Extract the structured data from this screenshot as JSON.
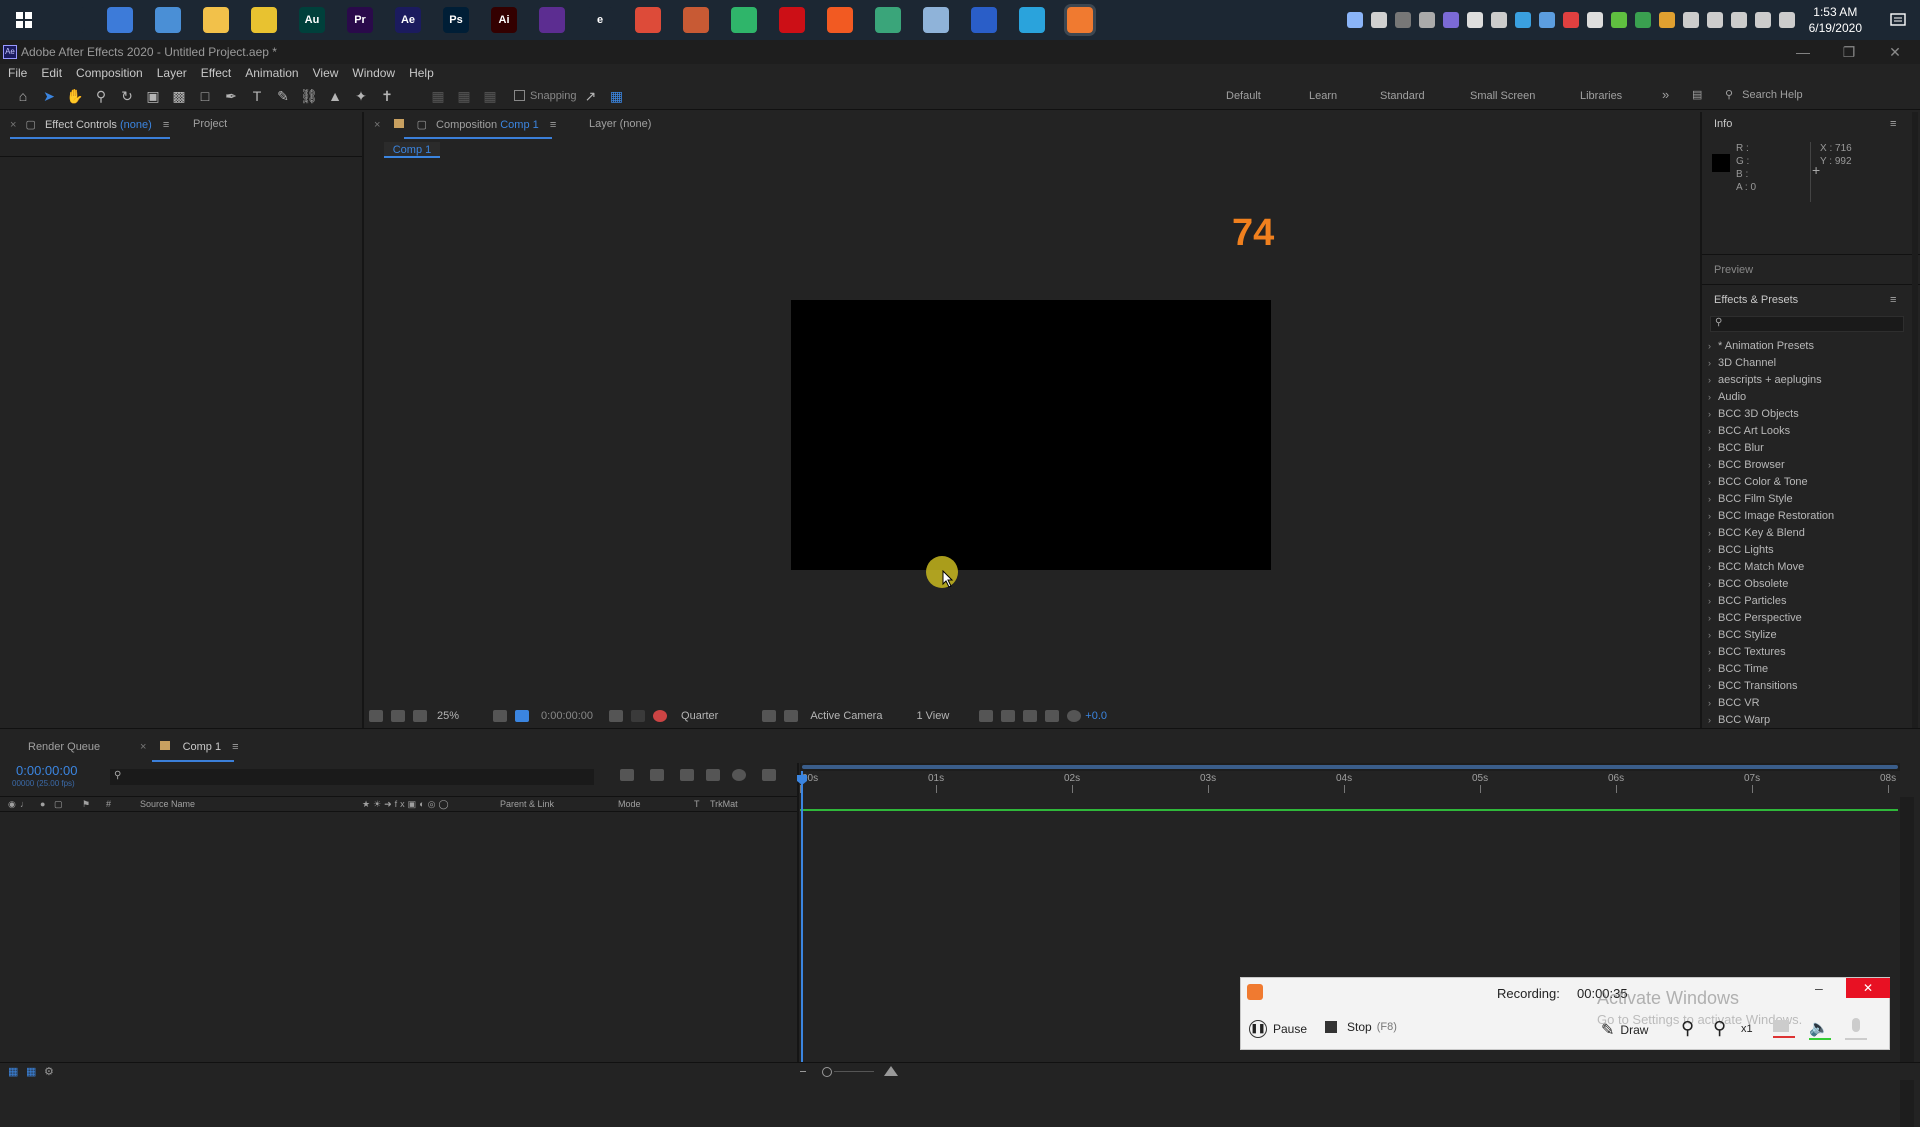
{
  "taskbar": {
    "apps": [
      {
        "name": "task-view-icon",
        "label": "",
        "color": "#1c2733"
      },
      {
        "name": "app-icon-1",
        "label": "",
        "color": "#3d7bd9"
      },
      {
        "name": "app-icon-2",
        "label": "",
        "color": "#4a8fd6"
      },
      {
        "name": "file-explorer-icon",
        "label": "",
        "color": "#f2c14a"
      },
      {
        "name": "app-icon-4",
        "label": "",
        "color": "#e8c230"
      },
      {
        "name": "audition-icon",
        "label": "Au",
        "color": "#00403b"
      },
      {
        "name": "premiere-icon",
        "label": "Pr",
        "color": "#2a0a4a"
      },
      {
        "name": "after-effects-icon",
        "label": "Ae",
        "color": "#1b1b5e"
      },
      {
        "name": "photoshop-icon",
        "label": "Ps",
        "color": "#001e36"
      },
      {
        "name": "illustrator-icon",
        "label": "Ai",
        "color": "#330000"
      },
      {
        "name": "visual-studio-icon",
        "label": "",
        "color": "#5c2d91"
      },
      {
        "name": "edge-legacy-icon",
        "label": "e",
        "color": "#1c2733"
      },
      {
        "name": "chrome-icon",
        "label": "",
        "color": "#dd4b39"
      },
      {
        "name": "chrome-alt-icon",
        "label": "",
        "color": "#c85a34"
      },
      {
        "name": "edge-dev-icon",
        "label": "",
        "color": "#2fb56a"
      },
      {
        "name": "opera-icon",
        "label": "",
        "color": "#cc0f16"
      },
      {
        "name": "brave-icon",
        "label": "",
        "color": "#f25a22"
      },
      {
        "name": "app-icon-17",
        "label": "",
        "color": "#3aa57a"
      },
      {
        "name": "app-icon-18",
        "label": "",
        "color": "#8fb3d9"
      },
      {
        "name": "app-icon-19",
        "label": "",
        "color": "#2a5ec8"
      },
      {
        "name": "telegram-icon",
        "label": "",
        "color": "#2aa3dc"
      },
      {
        "name": "recorder-app-icon",
        "label": "",
        "color": "#f07a30"
      }
    ],
    "clock_time": "1:53 AM",
    "clock_date": "6/19/2020"
  },
  "window": {
    "title": "Adobe After Effects 2020 - Untitled Project.aep *",
    "logo": "Ae"
  },
  "menu": [
    "File",
    "Edit",
    "Composition",
    "Layer",
    "Effect",
    "Animation",
    "View",
    "Window",
    "Help"
  ],
  "toolbar": {
    "snapping_label": "Snapping",
    "workspaces": [
      "Default",
      "Learn",
      "Standard",
      "Small Screen",
      "Libraries"
    ],
    "search_placeholder": "Search Help"
  },
  "left_panel": {
    "effect_controls_label": "Effect Controls",
    "effect_controls_value": "(none)",
    "project_label": "Project"
  },
  "comp_panel": {
    "tab_label": "Composition",
    "tab_value": "Comp 1",
    "layer_tab": "Layer (none)",
    "breadcrumb": "Comp 1",
    "overlay_number": "74",
    "zoom": "25%",
    "timecode": "0:00:00:00",
    "resolution": "Quarter",
    "camera": "Active Camera",
    "view": "1 View",
    "exposure": "+0.0"
  },
  "info_panel": {
    "title": "Info",
    "r": "R :",
    "g": "G :",
    "b": "B :",
    "a": "A :  0",
    "x": "X : 716",
    "y": "Y : 992"
  },
  "preview_panel": {
    "title": "Preview"
  },
  "effects_panel": {
    "title": "Effects & Presets",
    "items": [
      "* Animation Presets",
      "3D Channel",
      "aescripts + aeplugins",
      "Audio",
      "BCC 3D Objects",
      "BCC Art Looks",
      "BCC Blur",
      "BCC Browser",
      "BCC Color & Tone",
      "BCC Film Style",
      "BCC Image Restoration",
      "BCC Key & Blend",
      "BCC Lights",
      "BCC Match Move",
      "BCC Obsolete",
      "BCC Particles",
      "BCC Perspective",
      "BCC Stylize",
      "BCC Textures",
      "BCC Time",
      "BCC Transitions",
      "BCC VR",
      "BCC Warp"
    ]
  },
  "timeline": {
    "render_queue_tab": "Render Queue",
    "comp_tab": "Comp 1",
    "timecode": "0:00:00:00",
    "fps": "00000 (25.00 fps)",
    "col_source": "Source Name",
    "col_parent": "Parent & Link",
    "col_mode": "Mode",
    "col_t": "T",
    "col_trkmat": "TrkMat",
    "ruler": [
      "00s",
      "01s",
      "02s",
      "03s",
      "04s",
      "05s",
      "06s",
      "07s",
      "08s"
    ]
  },
  "recorder": {
    "status": "Recording:",
    "elapsed": "00:00:35",
    "pause_label": "Pause",
    "stop_label": "Stop",
    "stop_hotkey": "(F8)",
    "draw_label": "Draw",
    "zoom_level": "x1"
  },
  "watermark": {
    "line1": "Activate Windows",
    "line2": "Go to Settings to activate Windows."
  },
  "colors": {
    "accent_blue": "#3b85e0",
    "overlay_orange": "#f0801e",
    "timeline_green": "#2fb83a",
    "cursor_highlight": "#c8b820"
  }
}
